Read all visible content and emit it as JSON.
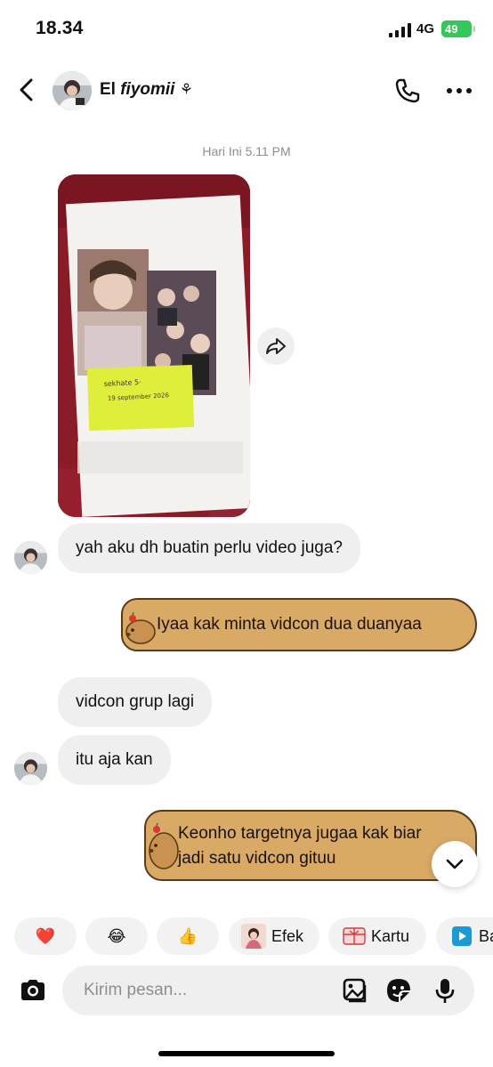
{
  "status_bar": {
    "time": "18.34",
    "network": "4G",
    "battery": "49"
  },
  "header": {
    "name_plain": "El ",
    "name_italic": "fiyomii",
    "name_symbol": "⚘",
    "back_icon": "chevron-left-icon",
    "call_icon": "phone-icon",
    "more_icon": "more-horizontal-icon"
  },
  "conversation": {
    "date_separator": "Hari Ini 5.11 PM",
    "photo_note": "sekhate 5·\n19 september 2026",
    "messages": [
      {
        "from": "them",
        "text": "yah aku dh buatin perlu video juga?"
      },
      {
        "from": "me",
        "lines": [
          "Iyaa kak minta vidcon dua duanyaa"
        ]
      },
      {
        "from": "them",
        "text": "vidcon grup lagi"
      },
      {
        "from": "them",
        "text": "itu aja kan"
      },
      {
        "from": "me",
        "lines": [
          "Keonho targetnya jugaa kak biar",
          "jadi satu vidcon gituu"
        ]
      }
    ]
  },
  "quick_reactions": [
    {
      "emoji": "❤️"
    },
    {
      "emoji": "😂"
    },
    {
      "emoji": "👍"
    },
    {
      "label": "Efek"
    },
    {
      "label": "Kartu"
    },
    {
      "label": "Ba"
    }
  ],
  "composer": {
    "placeholder": "Kirim pesan..."
  },
  "colors": {
    "bubble_in": "#efefef",
    "bubble_out": "#d9a966",
    "bubble_out_border": "#5b3a1c",
    "battery": "#34c759"
  }
}
